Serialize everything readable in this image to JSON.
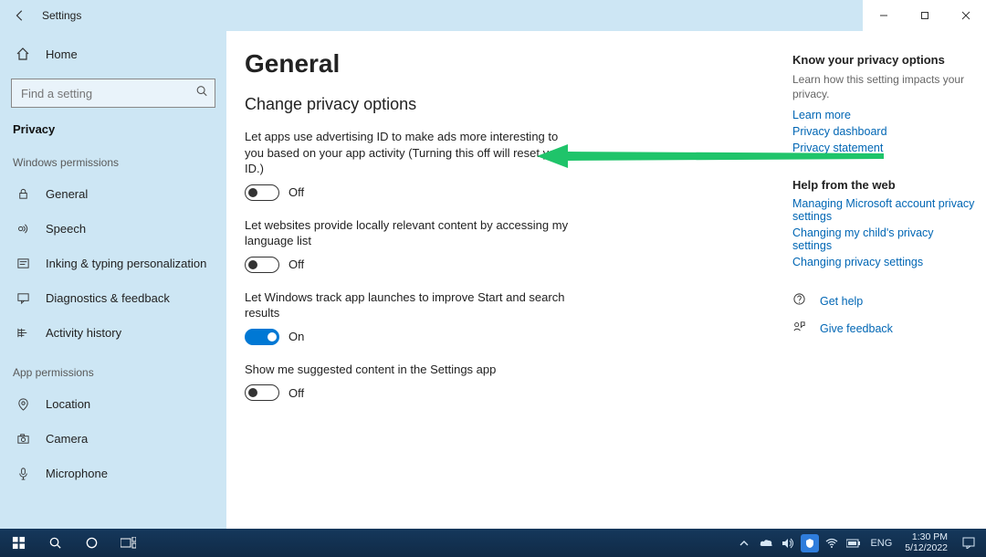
{
  "window": {
    "title": "Settings"
  },
  "sidebar": {
    "home": "Home",
    "search_placeholder": "Find a setting",
    "crumb": "Privacy",
    "section_windows": "Windows permissions",
    "section_app": "App permissions",
    "items_win": [
      {
        "label": "General"
      },
      {
        "label": "Speech"
      },
      {
        "label": "Inking & typing personalization"
      },
      {
        "label": "Diagnostics & feedback"
      },
      {
        "label": "Activity history"
      }
    ],
    "items_app": [
      {
        "label": "Location"
      },
      {
        "label": "Camera"
      },
      {
        "label": "Microphone"
      }
    ]
  },
  "page": {
    "title": "General",
    "subtitle": "Change privacy options",
    "settings": [
      {
        "desc": "Let apps use advertising ID to make ads more interesting to you based on your app activity (Turning this off will reset your ID.)",
        "state": "Off",
        "on": false
      },
      {
        "desc": "Let websites provide locally relevant content by accessing my language list",
        "state": "Off",
        "on": false
      },
      {
        "desc": "Let Windows track app launches to improve Start and search results",
        "state": "On",
        "on": true
      },
      {
        "desc": "Show me suggested content in the Settings app",
        "state": "Off",
        "on": false
      }
    ]
  },
  "side": {
    "know_head": "Know your privacy options",
    "know_text": "Learn how this setting impacts your privacy.",
    "links1": [
      "Learn more",
      "Privacy dashboard",
      "Privacy statement"
    ],
    "help_head": "Help from the web",
    "links2": [
      "Managing Microsoft account privacy settings",
      "Changing my child's privacy settings",
      "Changing privacy settings"
    ],
    "get_help": "Get help",
    "give_feedback": "Give feedback"
  },
  "taskbar": {
    "lang": "ENG",
    "time": "1:30 PM",
    "date": "5/12/2022"
  }
}
